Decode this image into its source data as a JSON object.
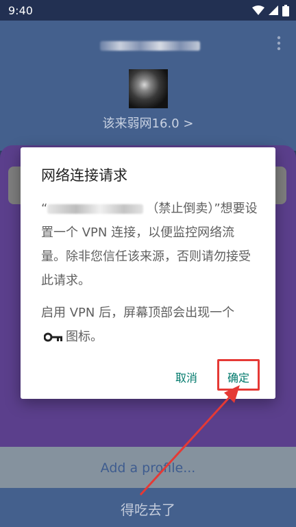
{
  "status_bar": {
    "time": "9:40",
    "icons": [
      "wifi-icon",
      "signal-icon",
      "battery-icon"
    ]
  },
  "app": {
    "subtitle": "该来弱网16.0 >",
    "add_profile": "Add a profile...",
    "bottom_text": "得吃去了"
  },
  "dialog": {
    "title": "网络连接请求",
    "body_suffix": "（禁止倒卖）”想要设置一个 VPN 连接，以便监控网络流量。除非您信任该来源，否则请勿接受此请求。",
    "body2_prefix": "启用 VPN 后，屏幕顶部会出现一个",
    "body2_suffix": "图标。",
    "cancel_label": "取消",
    "ok_label": "确定"
  },
  "colors": {
    "accent_button": "#00796b",
    "annotation_red": "#e53935"
  }
}
